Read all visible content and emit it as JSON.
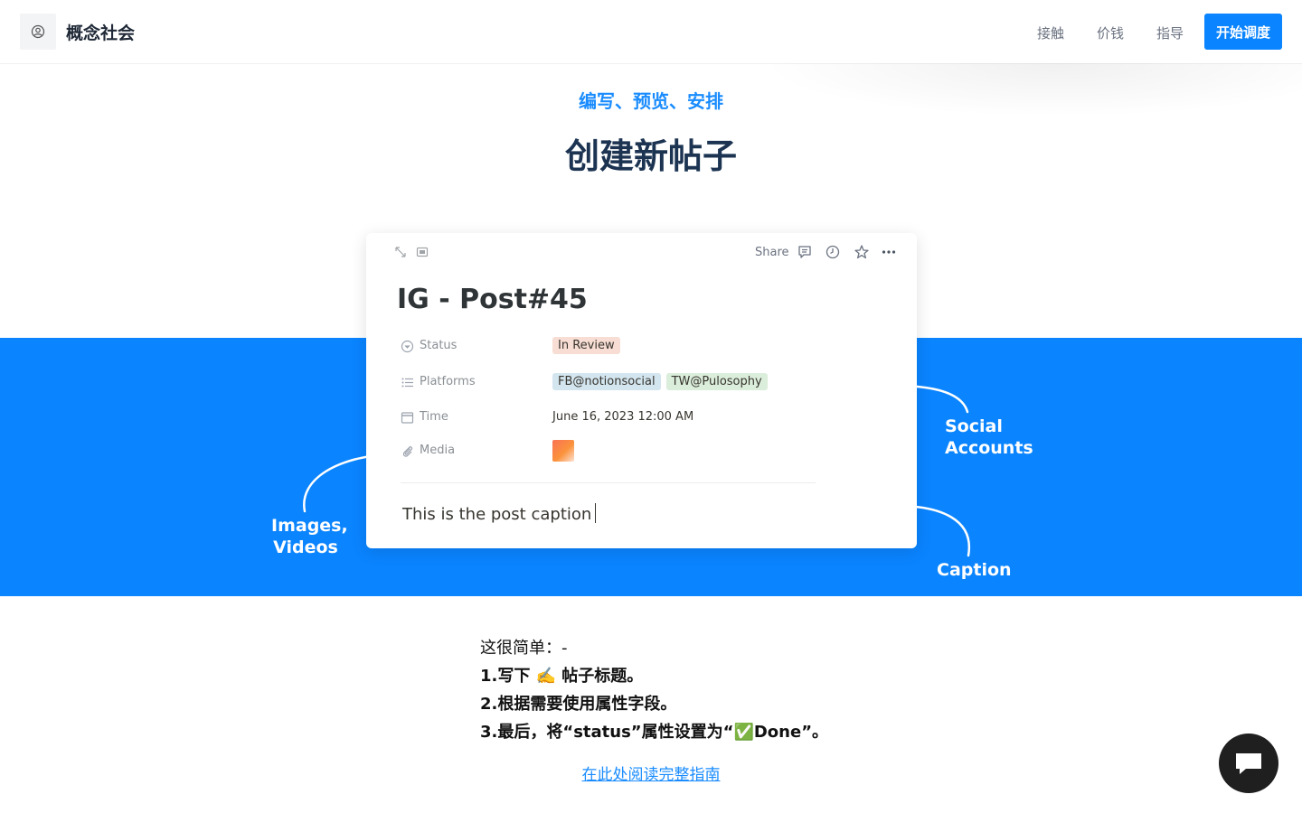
{
  "header": {
    "brand": "概念社会",
    "nav": [
      "接触",
      "价钱",
      "指导"
    ],
    "cta": "开始调度"
  },
  "hero": {
    "eyebrow": "编写、预览、安排",
    "title": "创建新帖子"
  },
  "card": {
    "share_label": "Share",
    "title": "IG - Post#45",
    "properties": {
      "status": {
        "label": "Status",
        "value": "In Review"
      },
      "platforms": {
        "label": "Platforms",
        "values": [
          "FB@notionsocial",
          "TW@Pulosophy"
        ]
      },
      "time": {
        "label": "Time",
        "value": "June 16, 2023 12:00 AM"
      },
      "media": {
        "label": "Media"
      }
    },
    "caption": "This is the post caption"
  },
  "annotations": {
    "images": [
      "Images,",
      "Videos"
    ],
    "social": [
      "Social",
      "Accounts"
    ],
    "caption": "Caption"
  },
  "steps": {
    "intro": "这很简单：-",
    "step1": "1.写下 ✍️ 帖子标题。",
    "step2": "2.根据需要使用属性字段。",
    "step3": "3.最后，将“status”属性设置为“✅Done”。"
  },
  "guide_link": "在此处阅读完整指南",
  "colors": {
    "accent": "#0a84ff",
    "title": "#1c3452",
    "status_tag": "#f7ddd3",
    "fb_tag": "#d3e5ef",
    "tw_tag": "#dbeddb"
  },
  "icons": [
    "user-circle-icon",
    "expand-icon",
    "layout-icon",
    "comment-icon",
    "history-icon",
    "star-icon",
    "more-icon",
    "status-icon",
    "list-icon",
    "calendar-icon",
    "paperclip-icon",
    "chat-icon"
  ]
}
